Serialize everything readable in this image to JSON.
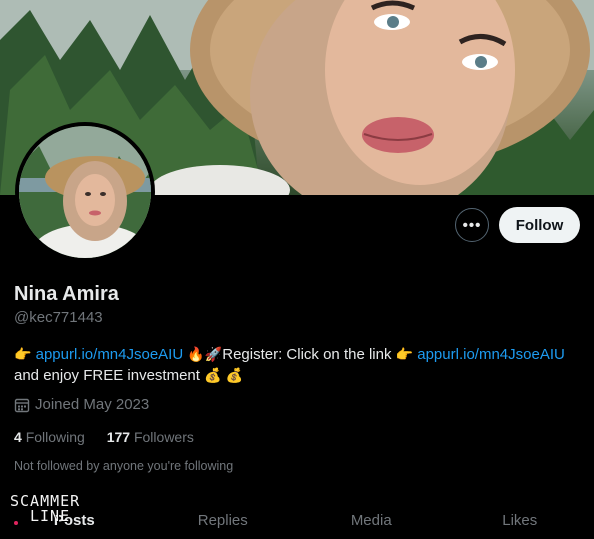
{
  "profile": {
    "name": "Nina Amira",
    "handle": "@kec771443",
    "follow_label": "Follow",
    "more_label": "•••",
    "bio": {
      "link1": "appurl.io/mn4JsoeAIU",
      "text1": "Register: Click on the link",
      "link2": "appurl.io/mn4JsoeAIU",
      "text2": "and enjoy FREE investment",
      "emoji_point": "👉",
      "emoji_fire": "🔥",
      "emoji_rocket": "🚀",
      "emoji_money": "💰"
    },
    "joined": "Joined May 2023",
    "following_count": "4",
    "following_label": "Following",
    "followers_count": "177",
    "followers_label": "Followers",
    "not_followed": "Not followed by anyone you're following"
  },
  "tabs": [
    "Posts",
    "Replies",
    "Media",
    "Likes"
  ],
  "watermark": {
    "line1": "SCAMMER",
    "line2": "LINE"
  },
  "colors": {
    "background": "#000000",
    "link": "#1d9bf0",
    "muted": "#71767b",
    "follow_button": "#eff3f4"
  },
  "icons": {
    "more": "more-horizontal-icon",
    "calendar": "calendar-icon"
  }
}
